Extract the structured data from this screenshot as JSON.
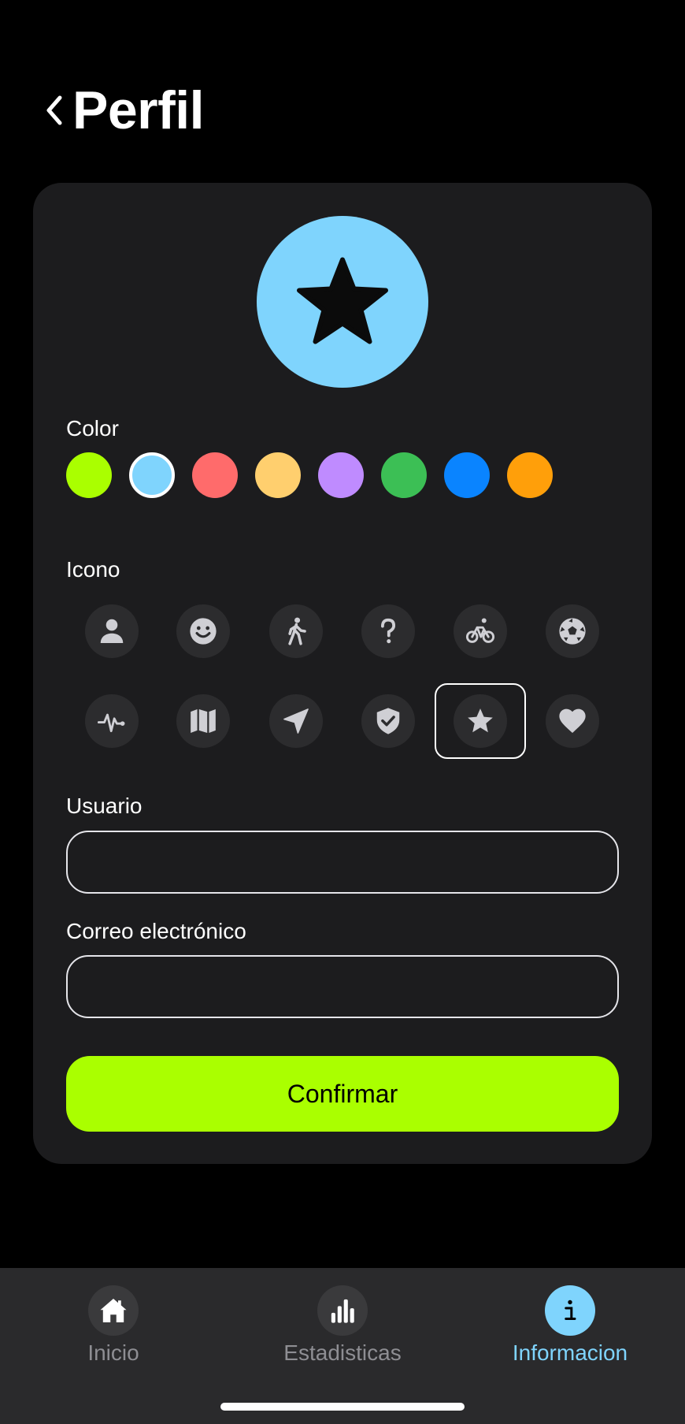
{
  "header": {
    "title": "Perfil",
    "back_icon": "chevron-left-icon"
  },
  "avatar": {
    "icon": "star-icon",
    "background": "#7fd4fd",
    "icon_color": "#0b0b0b"
  },
  "color_section": {
    "label": "Color",
    "selected_index": 1,
    "swatches": [
      "#aaff00",
      "#7fd4fd",
      "#ff6b6b",
      "#ffcf6e",
      "#bf8bff",
      "#3cbf55",
      "#0a84ff",
      "#ff9f0a"
    ]
  },
  "icon_section": {
    "label": "Icono",
    "selected_index": 10,
    "icons": [
      "person-icon",
      "smiley-icon",
      "walking-icon",
      "question-mark-icon",
      "bicycle-icon",
      "soccer-ball-icon",
      "heartbeat-icon",
      "map-icon",
      "location-arrow-icon",
      "shield-check-icon",
      "star-icon",
      "heart-icon"
    ]
  },
  "form": {
    "user_label": "Usuario",
    "user_value": "",
    "email_label": "Correo electrónico",
    "email_value": "",
    "confirm_label": "Confirmar",
    "confirm_color": "#aaff00"
  },
  "tabbar": {
    "active_color": "#7fd4fd",
    "tabs": [
      {
        "label": "Inicio",
        "icon": "house-icon",
        "active": false
      },
      {
        "label": "Estadisticas",
        "icon": "bar-chart-icon",
        "active": false
      },
      {
        "label": "Informacion",
        "icon": "info-icon",
        "active": true
      }
    ]
  }
}
